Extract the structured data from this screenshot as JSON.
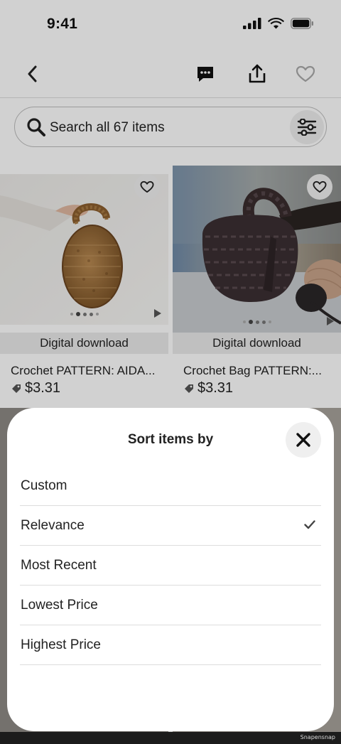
{
  "status_bar": {
    "time": "9:41"
  },
  "header": {
    "back_icon": "chevron-left-icon",
    "message_icon": "message-icon",
    "share_icon": "share-icon",
    "favorite_icon": "heart-outline-icon"
  },
  "search": {
    "placeholder": "Search all 67 items",
    "filter_icon": "sliders-icon"
  },
  "listings": [
    {
      "title": "Crochet PATTERN: AIDA...",
      "price": "$3.31",
      "tag": "Digital download",
      "image_desc": "tan crochet bag"
    },
    {
      "title": "Crochet Bag PATTERN:...",
      "price": "$3.31",
      "tag": "Digital download",
      "image_desc": "dark brown crochet bag"
    }
  ],
  "sort_sheet": {
    "title": "Sort items by",
    "options": [
      {
        "label": "Custom",
        "selected": false
      },
      {
        "label": "Relevance",
        "selected": true
      },
      {
        "label": "Most Recent",
        "selected": false
      },
      {
        "label": "Lowest Price",
        "selected": false
      },
      {
        "label": "Highest Price",
        "selected": false
      }
    ]
  },
  "watermark": "Snapensnap",
  "colors": {
    "text": "#222222",
    "dim_overlay": "rgba(0,0,0,0.18)",
    "sheet_bg": "#ffffff"
  }
}
